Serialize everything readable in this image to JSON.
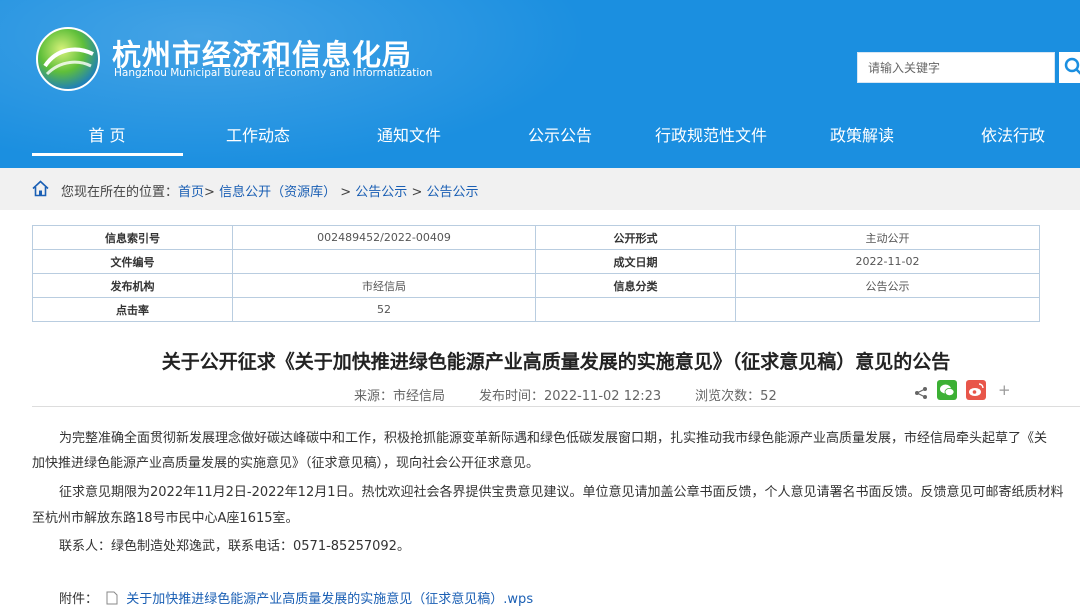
{
  "colors": {
    "header_bg": "#1b8fe0",
    "link": "#1a5fb4"
  },
  "header": {
    "title": "杭州市经济和信息化局",
    "subtitle": "Hangzhou Municipal Bureau of Economy and Informatization",
    "search_placeholder": "请输入关键字",
    "logo_icon": "globe-logo-icon",
    "search_icon": "magnifier-icon"
  },
  "nav": {
    "items": [
      {
        "label": "首 页"
      },
      {
        "label": "工作动态"
      },
      {
        "label": "通知文件"
      },
      {
        "label": "公示公告"
      },
      {
        "label": "行政规范性文件"
      },
      {
        "label": "政策解读"
      },
      {
        "label": "依法行政"
      }
    ]
  },
  "breadcrumb": {
    "prefix": "您现在所在的位置：",
    "items": [
      "首页",
      "信息公开（资源库）",
      "公告公示",
      "公告公示"
    ],
    "separator": ">"
  },
  "info_table": {
    "rows": [
      [
        "信息索引号",
        "002489452/2022-00409",
        "公开形式",
        "主动公开"
      ],
      [
        "文件编号",
        "",
        "成文日期",
        "2022-11-02"
      ],
      [
        "发布机构",
        "市经信局",
        "信息分类",
        "公告公示"
      ],
      [
        "点击率",
        "52",
        "",
        ""
      ]
    ]
  },
  "article": {
    "title": "关于公开征求《关于加快推进绿色能源产业高质量发展的实施意见》（征求意见稿）意见的公告",
    "source": "来源：市经信局",
    "published": "发布时间：2022-11-02 12:23",
    "views": "浏览次数：52",
    "share_icons": [
      "share-icon",
      "wechat-icon",
      "weibo-icon",
      "plus-icon"
    ],
    "share_more": "+",
    "body_lines": [
      "为完整准确全面贯彻新发展理念做好碳达峰碳中和工作，积极抢抓能源变革新际遇和绿色低碳发展窗口期，扎实推动我市绿色能源产业高质量发展，市经信局牵头起草了《关",
      "加快推进绿色能源产业高质量发展的实施意见》（征求意见稿），现向社会公开征求意见。",
      "征求意见期限为2022年11月2日-2022年12月1日。热忱欢迎社会各界提供宝贵意见建议。单位意见请加盖公章书面反馈，个人意见请署名书面反馈。反馈意见可邮寄纸质材料",
      "至杭州市解放东路18号市民中心A座1615室。",
      "联系人：绿色制造处郑逸武，联系电话：0571-85257092。"
    ],
    "attachment_label": "附件：",
    "attachment_name": "关于加快推进绿色能源产业高质量发展的实施意见（征求意见稿）.wps"
  }
}
